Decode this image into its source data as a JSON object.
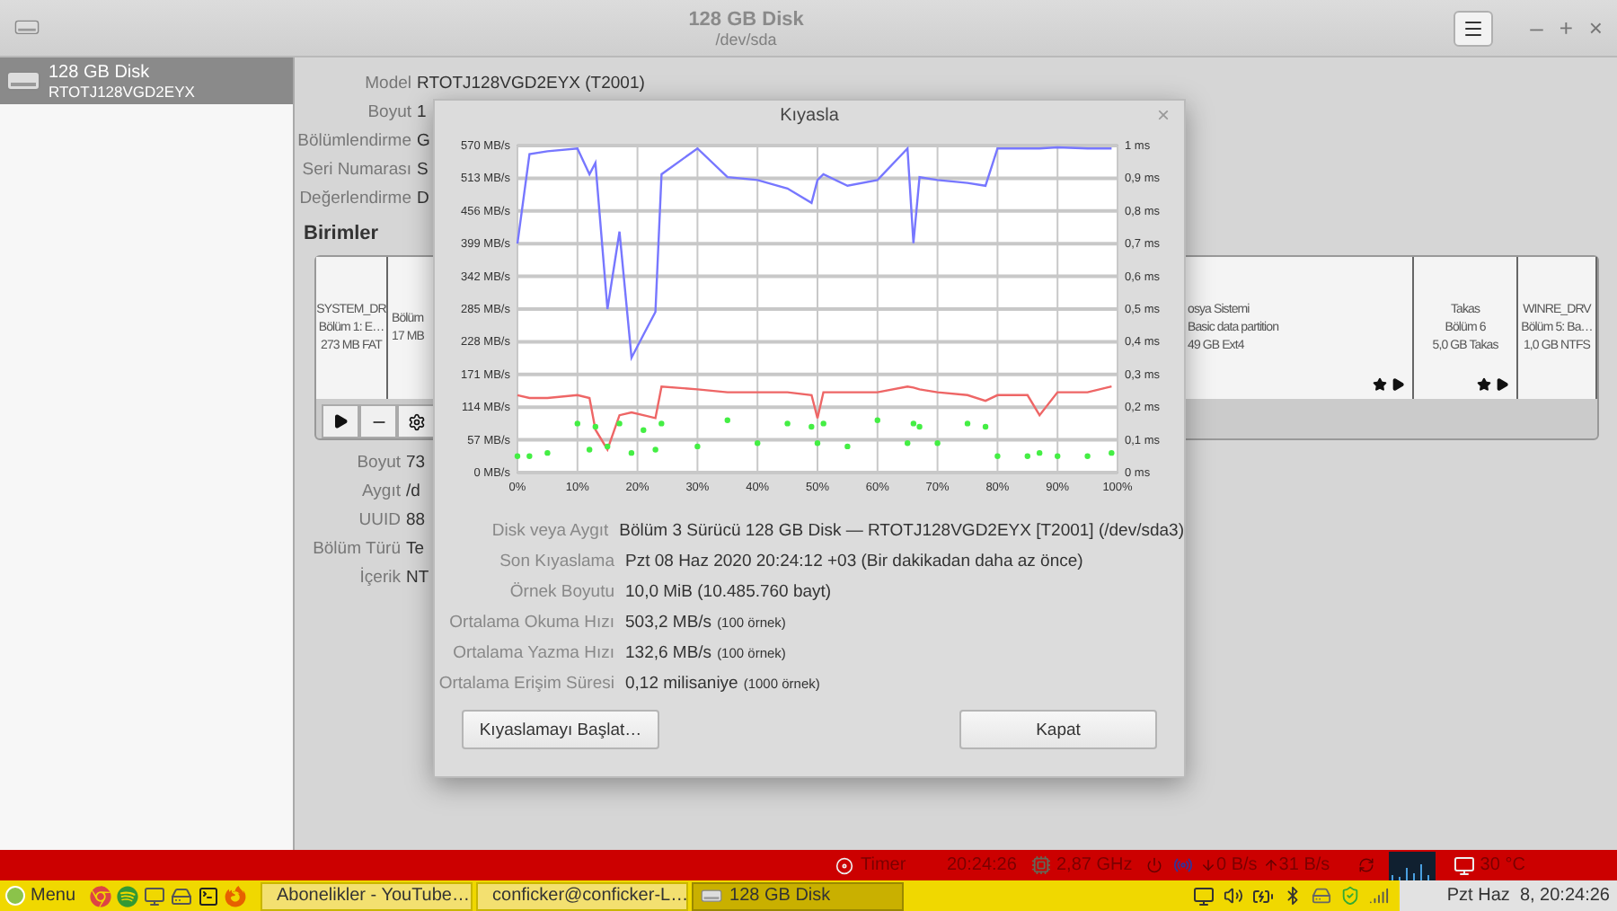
{
  "window": {
    "title": "128 GB Disk",
    "subtitle": "/dev/sda",
    "controls": [
      "–",
      "+",
      "×"
    ]
  },
  "sidebar": {
    "items": [
      {
        "title": "128 GB Disk",
        "subtitle": "RTOTJ128VGD2EYX",
        "selected": true
      }
    ]
  },
  "drive_info": [
    {
      "label": "Model",
      "value": "RTOTJ128VGD2EYX (T2001)"
    },
    {
      "label": "Boyut",
      "value": "1"
    },
    {
      "label": "Bölümlendirme",
      "value": "G"
    },
    {
      "label": "Seri Numarası",
      "value": "S"
    },
    {
      "label": "Değerlendirme",
      "value": "D"
    }
  ],
  "volumes": {
    "heading": "Birimler",
    "partitions": [
      {
        "lines": [
          "SYSTEM_DR",
          "Bölüm 1: E…",
          "273 MB FAT"
        ],
        "starred": false
      },
      {
        "lines": [
          "Bölüm",
          "17 MB"
        ]
      },
      {
        "lines": [
          "osya Sistemi",
          "Basic data partition",
          "49 GB Ext4"
        ],
        "starred": true
      },
      {
        "lines": [
          "Takas",
          "Bölüm 6",
          "5,0 GB Takas"
        ],
        "starred": true
      },
      {
        "lines": [
          "WINRE_DRV",
          "Bölüm 5: Ba…",
          "1,0 GB NTFS"
        ],
        "starred": false
      }
    ]
  },
  "volume_info": [
    {
      "label": "Boyut",
      "value": "73"
    },
    {
      "label": "Aygıt",
      "value": "/d"
    },
    {
      "label": "UUID",
      "value": "88"
    },
    {
      "label": "Bölüm Türü",
      "value": "Te"
    },
    {
      "label": "İçerik",
      "value": "NT"
    }
  ],
  "dialog": {
    "title": "Kıyasla",
    "close": "×",
    "chart_data": {
      "type": "line",
      "grid": true,
      "xlim": [
        0,
        100
      ],
      "ylim": [
        0,
        570
      ],
      "y2lim": [
        0,
        1
      ],
      "y2ticks": [
        {
          "value": 0,
          "label": "0 ms"
        },
        {
          "value": 0.1,
          "label": "0,1 ms"
        },
        {
          "value": 0.2,
          "label": "0,2 ms"
        },
        {
          "value": 0.3,
          "label": "0,3 ms"
        },
        {
          "value": 0.4,
          "label": "0,4 ms"
        },
        {
          "value": 0.5,
          "label": "0,5 ms"
        },
        {
          "value": 0.6,
          "label": "0,6 ms"
        },
        {
          "value": 0.7,
          "label": "0,7 ms"
        },
        {
          "value": 0.8,
          "label": "0,8 ms"
        },
        {
          "value": 0.9,
          "label": "0,9 ms"
        },
        {
          "value": 1,
          "label": "1 ms"
        }
      ],
      "x": [
        0,
        2,
        5,
        10,
        12,
        13,
        15,
        17,
        19,
        21,
        23,
        24,
        30,
        35,
        40,
        45,
        49,
        50,
        51,
        55,
        60,
        65,
        66,
        67,
        70,
        75,
        78,
        80,
        85,
        87,
        90,
        95,
        99
      ],
      "series": [
        {
          "color": "#7777ff",
          "values": [
            399,
            555,
            560,
            565,
            520,
            540,
            285,
            420,
            200,
            240,
            280,
            520,
            565,
            515,
            510,
            495,
            470,
            510,
            520,
            500,
            510,
            565,
            400,
            515,
            510,
            505,
            500,
            565,
            565,
            565,
            567,
            565,
            565
          ]
        },
        {
          "color": "#ee6666",
          "values": [
            135,
            130,
            130,
            135,
            130,
            75,
            40,
            100,
            105,
            100,
            95,
            150,
            145,
            140,
            140,
            140,
            135,
            95,
            140,
            140,
            140,
            150,
            148,
            145,
            140,
            135,
            125,
            135,
            135,
            100,
            140,
            140,
            150
          ]
        },
        {
          "color": "#44ee44",
          "axis": "y2",
          "type": "scatter",
          "values": [
            0.05,
            0.05,
            0.06,
            0.15,
            0.07,
            0.14,
            0.08,
            0.15,
            0.06,
            0.13,
            0.07,
            0.15,
            0.08,
            0.16,
            0.09,
            0.15,
            0.14,
            0.09,
            0.15,
            0.08,
            0.16,
            0.09,
            0.15,
            0.14,
            0.09,
            0.15,
            0.14,
            0.05,
            0.05,
            0.06,
            0.05,
            0.05,
            0.06
          ]
        }
      ],
      "xticks": [
        {
          "value": 0,
          "label": "0%"
        },
        {
          "value": 10,
          "label": "10%"
        },
        {
          "value": 20,
          "label": "20%"
        },
        {
          "value": 30,
          "label": "30%"
        },
        {
          "value": 40,
          "label": "40%"
        },
        {
          "value": 50,
          "label": "50%"
        },
        {
          "value": 60,
          "label": "60%"
        },
        {
          "value": 70,
          "label": "70%"
        },
        {
          "value": 80,
          "label": "80%"
        },
        {
          "value": 90,
          "label": "90%"
        },
        {
          "value": 100,
          "label": "100%"
        }
      ],
      "yticks": [
        {
          "value": 0,
          "label": "0 MB/s"
        },
        {
          "value": 57,
          "label": "57 MB/s"
        },
        {
          "value": 114,
          "label": "114 MB/s"
        },
        {
          "value": 171,
          "label": "171 MB/s"
        },
        {
          "value": 228,
          "label": "228 MB/s"
        },
        {
          "value": 285,
          "label": "285 MB/s"
        },
        {
          "value": 342,
          "label": "342 MB/s"
        },
        {
          "value": 399,
          "label": "399 MB/s"
        },
        {
          "value": 456,
          "label": "456 MB/s"
        },
        {
          "value": 513,
          "label": "513 MB/s"
        },
        {
          "value": 570,
          "label": "570 MB/s"
        }
      ]
    },
    "info": [
      {
        "label": "Disk veya Aygıt",
        "value": "Bölüm 3 Sürücü 128 GB Disk — RTOTJ128VGD2EYX [T2001] (/dev/sda3)"
      },
      {
        "label": "Son Kıyaslama",
        "value": "Pzt 08 Haz 2020 20:24:12 +03 (Bir dakikadan daha az önce)"
      },
      {
        "label": "Örnek Boyutu",
        "value": "10,0 MiB (10.485.760 bayt)"
      },
      {
        "label": "Ortalama Okuma Hızı",
        "value": "503,2 MB/s",
        "note": "(100 örnek)"
      },
      {
        "label": "Ortalama Yazma Hızı",
        "value": "132,6 MB/s",
        "note": "(100 örnek)"
      },
      {
        "label": "Ortalama Erişim Süresi",
        "value": "0,12 milisaniye",
        "note": "(1000 örnek)"
      }
    ],
    "buttons": [
      "Kıyaslamayı Başlat…",
      "Kapat"
    ]
  },
  "panel": {
    "timer": "Timer",
    "clock": "20:24:26",
    "cpu": "2,87 GHz",
    "down": "0 B/s",
    "up": "31 B/s",
    "temperature": "30 °C"
  },
  "taskbar": {
    "menu": "Menu",
    "tasks": [
      {
        "kind": "browser",
        "label": "Abonelikler - YouTube…",
        "selected": false
      },
      {
        "kind": "terminal",
        "label": "conficker@conficker-L…",
        "selected": false
      },
      {
        "kind": "disk",
        "label": "128 GB Disk",
        "selected": true
      }
    ],
    "clock": "Pzt Haz  8, 20:24:26"
  }
}
